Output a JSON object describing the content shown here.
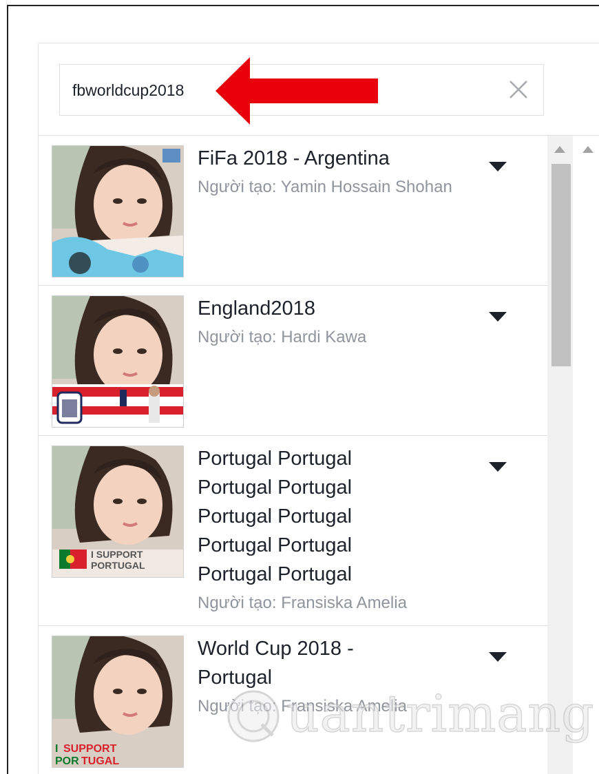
{
  "search": {
    "value": "fbworldcup2018"
  },
  "icons": {
    "clear": "close-icon",
    "arrow": "red-left-arrow",
    "caret": "caret-down-icon"
  },
  "colors": {
    "arrow": "#e8000b",
    "creator_text": "#90949c",
    "title_text": "#1d2129"
  },
  "results": [
    {
      "title": "FiFa 2018 - Argentina",
      "creator_prefix": "Người tạo: ",
      "creator_name": "Yamin Hossain Shohan",
      "frame_theme": "Argentina"
    },
    {
      "title": "England2018",
      "creator_prefix": "Người tạo: ",
      "creator_name": "Hardi Kawa",
      "frame_theme": "England"
    },
    {
      "title": "Portugal Portugal Portugal Portugal Portugal Portugal Portugal Portugal Portugal Portugal",
      "creator_prefix": "Người tạo: ",
      "creator_name": "Fransiska Amelia",
      "frame_theme": "Portugal",
      "frame_text_line1": "I SUPPORT",
      "frame_text_line2": "PORTUGAL"
    },
    {
      "title": "World Cup 2018 - Portugal",
      "creator_prefix": "Người tạo: ",
      "creator_name": "Fransiska Amelia",
      "frame_theme": "Portugal",
      "frame_text_line1": "I SUPPORT",
      "frame_text_line2": "PORTUGAL"
    }
  ],
  "watermark": {
    "text": "uantrimang"
  }
}
